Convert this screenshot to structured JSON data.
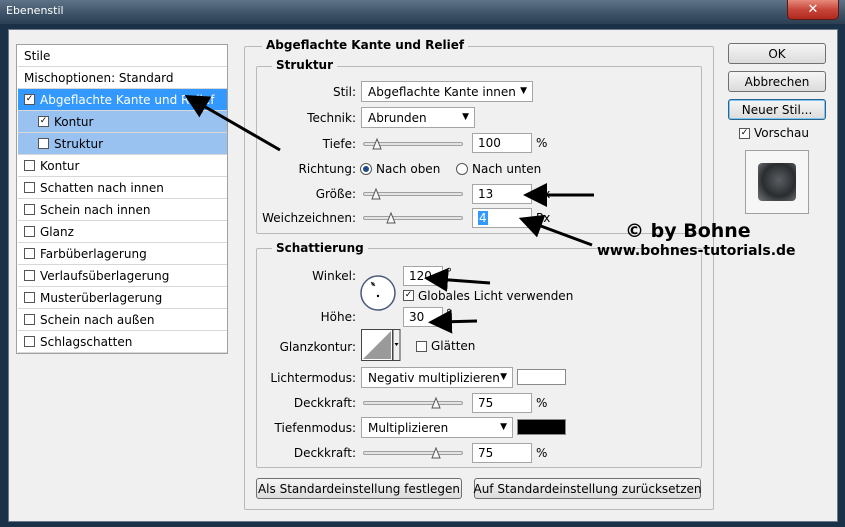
{
  "window": {
    "title": "Ebenenstil",
    "close_glyph": "✕"
  },
  "style_list": {
    "header": "Stile",
    "blend_options": "Mischoptionen: Standard",
    "items": [
      {
        "label": "Abgeflachte Kante und Relief",
        "checked": true,
        "state": "selected"
      },
      {
        "label": "Kontur",
        "checked": true,
        "state": "sub"
      },
      {
        "label": "Struktur",
        "checked": false,
        "state": "sub"
      },
      {
        "label": "Kontur",
        "checked": false
      },
      {
        "label": "Schatten nach innen",
        "checked": false
      },
      {
        "label": "Schein nach innen",
        "checked": false
      },
      {
        "label": "Glanz",
        "checked": false
      },
      {
        "label": "Farbüberlagerung",
        "checked": false
      },
      {
        "label": "Verlaufsüberlagerung",
        "checked": false
      },
      {
        "label": "Musterüberlagerung",
        "checked": false
      },
      {
        "label": "Schein nach außen",
        "checked": false
      },
      {
        "label": "Schlagschatten",
        "checked": false
      }
    ]
  },
  "panel": {
    "title": "Abgeflachte Kante und Relief",
    "structure": {
      "title": "Struktur",
      "style_label": "Stil:",
      "style_value": "Abgeflachte Kante innen",
      "technique_label": "Technik:",
      "technique_value": "Abrunden",
      "depth_label": "Tiefe:",
      "depth_value": "100",
      "depth_unit": "%",
      "depth_fraction": 0.1,
      "direction_label": "Richtung:",
      "direction_up": "Nach oben",
      "direction_down": "Nach unten",
      "size_label": "Größe:",
      "size_value": "13",
      "size_unit": "Px",
      "size_fraction": 0.09,
      "soften_label": "Weichzeichnen:",
      "soften_value": "4",
      "soften_unit": "Px",
      "soften_fraction": 0.25
    },
    "shading": {
      "title": "Schattierung",
      "angle_label": "Winkel:",
      "angle_value": "120",
      "angle_unit": "°",
      "global_light_label": "Globales Licht verwenden",
      "altitude_label": "Höhe:",
      "altitude_value": "30",
      "altitude_unit": "°",
      "gloss_contour_label": "Glanzkontur:",
      "antialias_label": "Glätten",
      "highlight_mode_label": "Lichtermodus:",
      "highlight_mode_value": "Negativ multiplizieren",
      "highlight_color": "#ffffff",
      "highlight_opacity_label": "Deckkraft:",
      "highlight_opacity_value": "75",
      "highlight_opacity_unit": "%",
      "highlight_opacity_fraction": 0.75,
      "shadow_mode_label": "Tiefenmodus:",
      "shadow_mode_value": "Multiplizieren",
      "shadow_color": "#000000",
      "shadow_opacity_label": "Deckkraft:",
      "shadow_opacity_value": "75",
      "shadow_opacity_unit": "%",
      "shadow_opacity_fraction": 0.75
    },
    "make_default_label": "Als Standardeinstellung festlegen",
    "reset_default_label": "Auf Standardeinstellung zurücksetzen"
  },
  "actions": {
    "ok": "OK",
    "cancel": "Abbrechen",
    "new_style": "Neuer Stil...",
    "preview_label": "Vorschau"
  },
  "watermark": {
    "title": "© by Bohne",
    "url": "www.bohnes-tutorials.de"
  },
  "colors": {
    "selection": "#3399ff",
    "sub_selection": "#99c2f0"
  }
}
